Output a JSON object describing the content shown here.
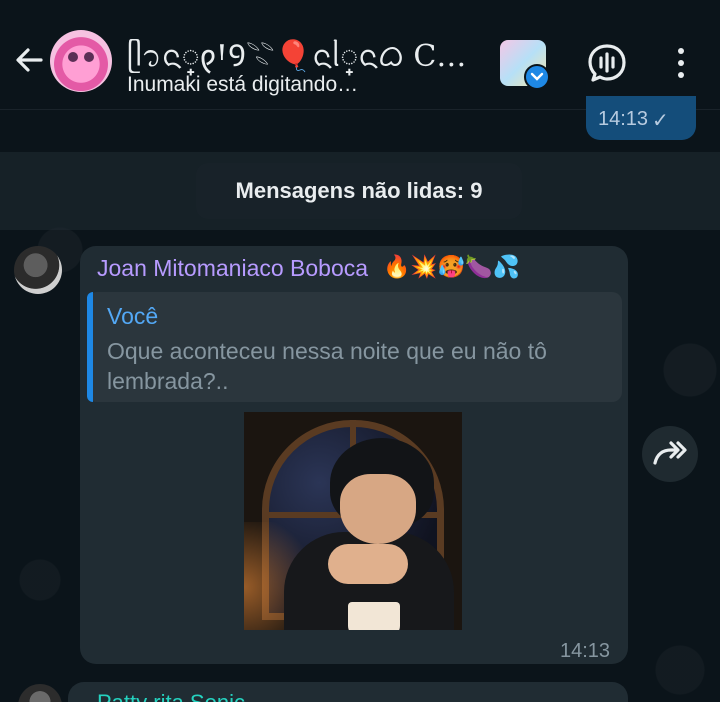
{
  "header": {
    "title": "ᥫ᭡ᨶ꫶𐑞ꞋꝮ𓇢🎈ᨶᥣ꫶ᨶᜊ Cħⱥt Ge…",
    "subtitle": "Inumaki está digitando…"
  },
  "previous_message": {
    "time": "14:13",
    "status": "✓"
  },
  "unread_banner": "Mensagens não lidas: 9",
  "message": {
    "sender": "Joan Mitomaniaco Boboca",
    "sender_emoji": "🔥💥🥵🍆💦",
    "quote": {
      "author": "Você",
      "text": "Oque aconteceu nessa noite que eu não tô lembrada?.."
    },
    "time": "14:13"
  },
  "next_message": {
    "sender": "Patty rita Sonic"
  },
  "colors": {
    "background": "#0b141a",
    "bubble_in": "#202c33",
    "bubble_out": "#144d7a",
    "sender_name": "#b79bff",
    "quote_accent": "#1e88e5"
  }
}
